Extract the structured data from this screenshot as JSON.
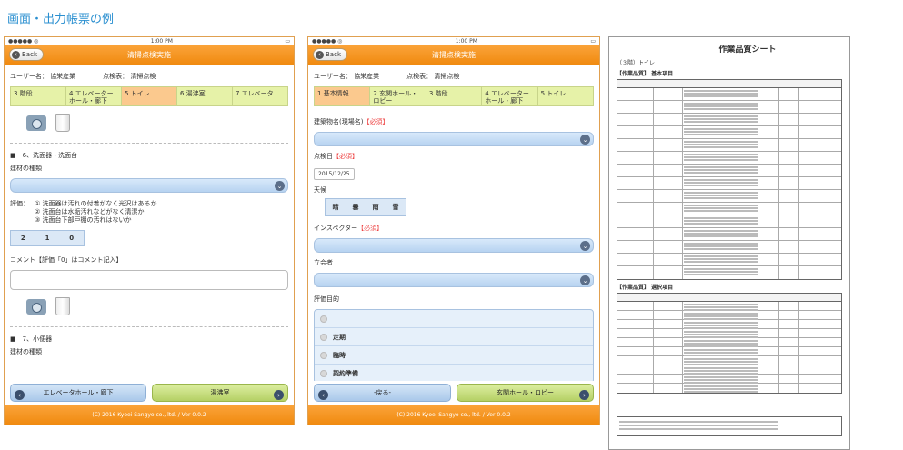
{
  "heading": "画面・出力帳票の例",
  "app": {
    "title": "清掃点検実施",
    "back_label": "Back",
    "status_left": "●●●●● ◎",
    "status_center": "1:00 PM",
    "status_right": "▭",
    "footer": "(C) 2016 Kyoei Sangyo co., ltd. / Ver 0.0.2"
  },
  "screen1": {
    "user_label": "ユーザー名： 協栄産業",
    "checker_label": "点検表： 清掃点検",
    "tabs": [
      "3.階段",
      "4.エレベーターホール・廊下",
      "5.トイレ",
      "6.湯沸室",
      "7.エレベータ"
    ],
    "section6": "■　6、洗面器・洗面台",
    "material_label": "建材の種類",
    "eval_label": "評価：",
    "eval_items": [
      "① 洗面器は汚れの付着がなく光沢はあるか",
      "② 洗面台は水垢汚れなどがなく清潔か",
      "③ 洗面台下部戸棚の汚れはないか"
    ],
    "scores": [
      "2",
      "1",
      "0"
    ],
    "comment_label": "コメント【評価「0」はコメント記入】",
    "section7": "■　7、小便器",
    "material_label2": "建材の種類",
    "prev_button": "エレベータホール・廊下",
    "next_button": "湯沸室"
  },
  "screen2": {
    "user_label": "ユーザー名： 協栄産業",
    "checker_label": "点検表： 清掃点検",
    "tabs": [
      "1.基本情報",
      "2.玄関ホール・ロビー",
      "3.階段",
      "4.エレベーターホール・廊下",
      "5.トイレ"
    ],
    "building_label": "建築物名(現場名)",
    "required": "【必須】",
    "date_label": "点検日",
    "date_value": "2015/12/25",
    "weather_label": "天候",
    "weather": [
      "晴",
      "曇",
      "雨",
      "雪"
    ],
    "inspector_label": "インスペクター",
    "witness_label": "立会者",
    "purpose_label": "評価目的",
    "purposes": [
      "",
      "定期",
      "臨時",
      "契約準備"
    ],
    "prev_button": "-戻る-",
    "next_button": "玄関ホール・ロビー"
  },
  "sheet": {
    "title": "作業品質シート",
    "sub": "（３階）トイレ",
    "basic": "【作業品質】 基本項目",
    "select": "【作業品質】 選択項目"
  }
}
